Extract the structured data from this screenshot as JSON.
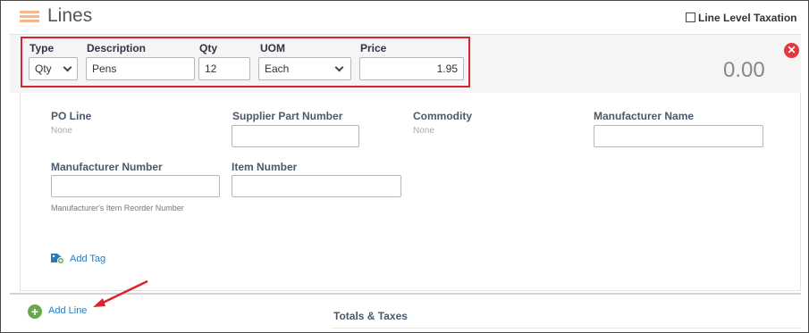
{
  "header": {
    "title": "Lines",
    "line_level_taxation": "Line Level Taxation"
  },
  "line": {
    "type_label": "Type",
    "type_value": "Qty",
    "description_label": "Description",
    "description_value": "Pens",
    "qty_label": "Qty",
    "qty_value": "12",
    "uom_label": "UOM",
    "uom_value": "Each",
    "price_label": "Price",
    "price_value": "1.95",
    "total": "0.00"
  },
  "details": {
    "po_line_label": "PO Line",
    "po_line_value": "None",
    "supplier_part_label": "Supplier Part Number",
    "commodity_label": "Commodity",
    "commodity_value": "None",
    "manufacturer_name_label": "Manufacturer Name",
    "manufacturer_number_label": "Manufacturer Number",
    "manufacturer_number_hint": "Manufacturer's Item Reorder Number",
    "item_number_label": "Item Number",
    "add_tag": "Add Tag"
  },
  "footer": {
    "add_line": "Add Line",
    "totals_taxes": "Totals & Taxes"
  },
  "colors": {
    "highlight_box": "#d9232e",
    "link": "#2a7ab8",
    "add_icon": "#6aa84f",
    "remove_icon": "#e0393e",
    "section_icon": "#f5b88c"
  },
  "icons": {
    "section": "lines-icon",
    "remove": "remove-line-icon",
    "tag": "add-tag-icon",
    "add": "add-line-icon",
    "annotation": "red-arrow-annotation"
  }
}
